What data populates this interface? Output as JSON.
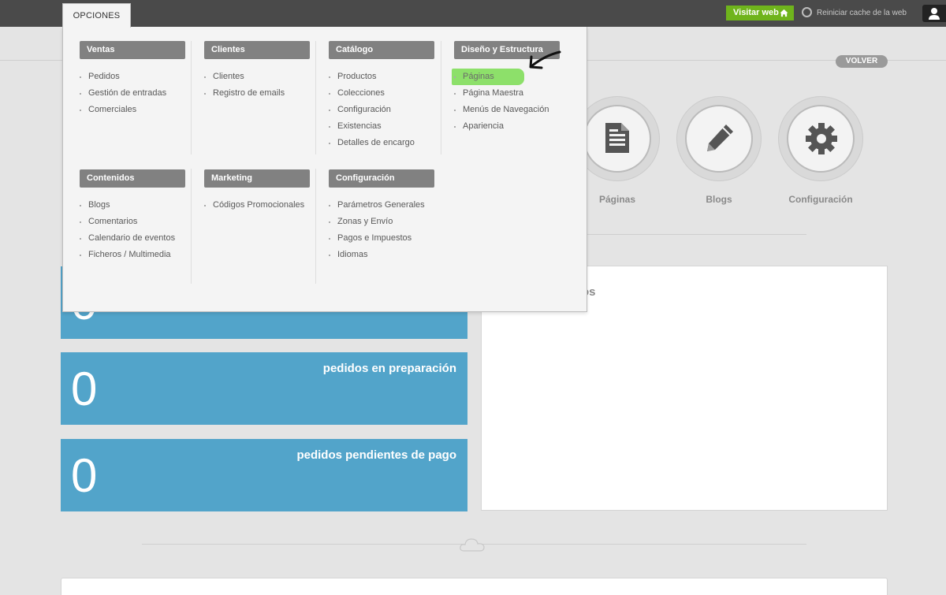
{
  "topbar": {
    "options_tab": "OPCIONES",
    "visit_web": "Visitar web",
    "reset_cache": "Reiniciar cache de la web"
  },
  "page": {
    "back_button": "VOLVER",
    "shortcuts": [
      {
        "label": "Páginas",
        "icon": "document-icon"
      },
      {
        "label": "Blogs",
        "icon": "pencil-icon"
      },
      {
        "label": "Configuración",
        "icon": "gear-icon"
      }
    ],
    "stats": [
      {
        "number": "0",
        "label": ""
      },
      {
        "number": "0",
        "label": "pedidos en preparación"
      },
      {
        "number": "0",
        "label": "pedidos pendientes de pago"
      }
    ],
    "panel_title_partial": "os"
  },
  "menu": {
    "groups": [
      {
        "title": "Ventas",
        "items": [
          "Pedidos",
          "Gestión de entradas",
          "Comerciales"
        ]
      },
      {
        "title": "Clientes",
        "items": [
          "Clientes",
          "Registro de emails"
        ]
      },
      {
        "title": "Catálogo",
        "items": [
          "Productos",
          "Colecciones",
          "Configuración",
          "Existencias",
          "Detalles de encargo"
        ]
      },
      {
        "title": "Diseño y Estructura",
        "items": [
          "Páginas",
          "Página Maestra",
          "Menús de Navegación",
          "Apariencia"
        ]
      },
      {
        "title": "Contenidos",
        "items": [
          "Blogs",
          "Comentarios",
          "Calendario de eventos",
          "Ficheros / Multimedia"
        ]
      },
      {
        "title": "Marketing",
        "items": [
          "Códigos Promocionales"
        ]
      },
      {
        "title": "Configuración",
        "items": [
          "Parámetros Generales",
          "Zonas y Envío",
          "Pagos e Impuestos",
          "Idiomas"
        ]
      }
    ],
    "highlighted_item": "Páginas",
    "highlight_color": "#8de06a"
  },
  "colors": {
    "topbar": "#4a4a4a",
    "visit_button": "#6fb41c",
    "stat_box": "#52a4ca",
    "menu_header": "#818181"
  }
}
